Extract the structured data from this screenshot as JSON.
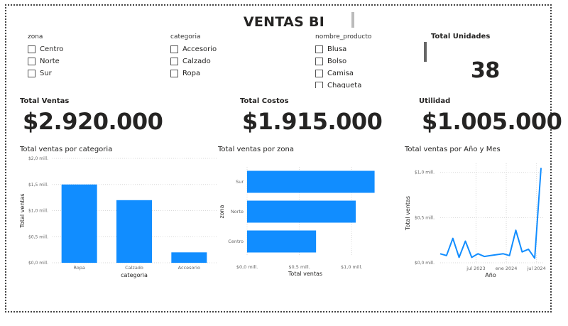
{
  "title": "VENTAS BI",
  "slicers": {
    "zona": {
      "label": "zona",
      "options": [
        "Centro",
        "Norte",
        "Sur"
      ]
    },
    "categoria": {
      "label": "categoria",
      "options": [
        "Accesorio",
        "Calzado",
        "Ropa"
      ]
    },
    "producto": {
      "label": "nombre_producto",
      "options": [
        "Blusa",
        "Bolso",
        "Camisa",
        "Chaqueta"
      ]
    }
  },
  "kpis": {
    "unidades": {
      "label": "Total Unidades",
      "value": "38"
    },
    "ventas": {
      "label": "Total Ventas",
      "value": "$2.920.000"
    },
    "costos": {
      "label": "Total Costos",
      "value": "$1.915.000"
    },
    "utilidad": {
      "label": "Utilidad",
      "value": "$1.005.000"
    }
  },
  "colors": {
    "accent": "#118DFF",
    "grid": "#d9d9d9",
    "tick": "#666666"
  },
  "chart_data": [
    {
      "type": "bar",
      "title": "Total ventas por categoria",
      "xlabel": "categoria",
      "ylabel": "Total ventas",
      "categories": [
        "Ropa",
        "Calzado",
        "Accesorio"
      ],
      "values": [
        1.5,
        1.2,
        0.2
      ],
      "unit": "mill.",
      "ylim": [
        0,
        2
      ],
      "yticks": [
        "$0,0 mill.",
        "$0,5 mill.",
        "$1,0 mill.",
        "$1,5 mill.",
        "$2,0 mill."
      ],
      "grid": true
    },
    {
      "type": "bar",
      "orientation": "horizontal",
      "title": "Total ventas por zona",
      "xlabel": "Total ventas",
      "ylabel": "zona",
      "categories": [
        "Sur",
        "Norte",
        "Centro"
      ],
      "values": [
        1.22,
        1.04,
        0.66
      ],
      "unit": "mill.",
      "xlim": [
        0,
        1.25
      ],
      "xticks": [
        "$0,0 mill.",
        "$0,5 mill.",
        "$1,0 mill."
      ],
      "grid": true
    },
    {
      "type": "line",
      "title": "Total ventas por Año y Mes",
      "xlabel": "Año",
      "ylabel": "Total ventas",
      "x": [
        "2023-01",
        "2023-02",
        "2023-03",
        "2023-04",
        "2023-05",
        "2023-06",
        "2023-07",
        "2023-08",
        "2023-09",
        "2023-10",
        "2023-11",
        "2023-12",
        "2024-01",
        "2024-02",
        "2024-03",
        "2024-04",
        "2024-05",
        "2024-06",
        "2024-07"
      ],
      "values": [
        0.1,
        0.08,
        0.27,
        0.06,
        0.24,
        0.06,
        0.1,
        0.07,
        0.08,
        0.09,
        0.1,
        0.08,
        0.36,
        0.12,
        0.15,
        0.05,
        1.05
      ],
      "unit": "mill.",
      "ylim": [
        0,
        1.1
      ],
      "yticks": [
        "$0,0 mill.",
        "$0,5 mill.",
        "$1,0 mill."
      ],
      "xticks": [
        "jul 2023",
        "ene 2024",
        "jul 2024"
      ],
      "grid": true
    }
  ]
}
